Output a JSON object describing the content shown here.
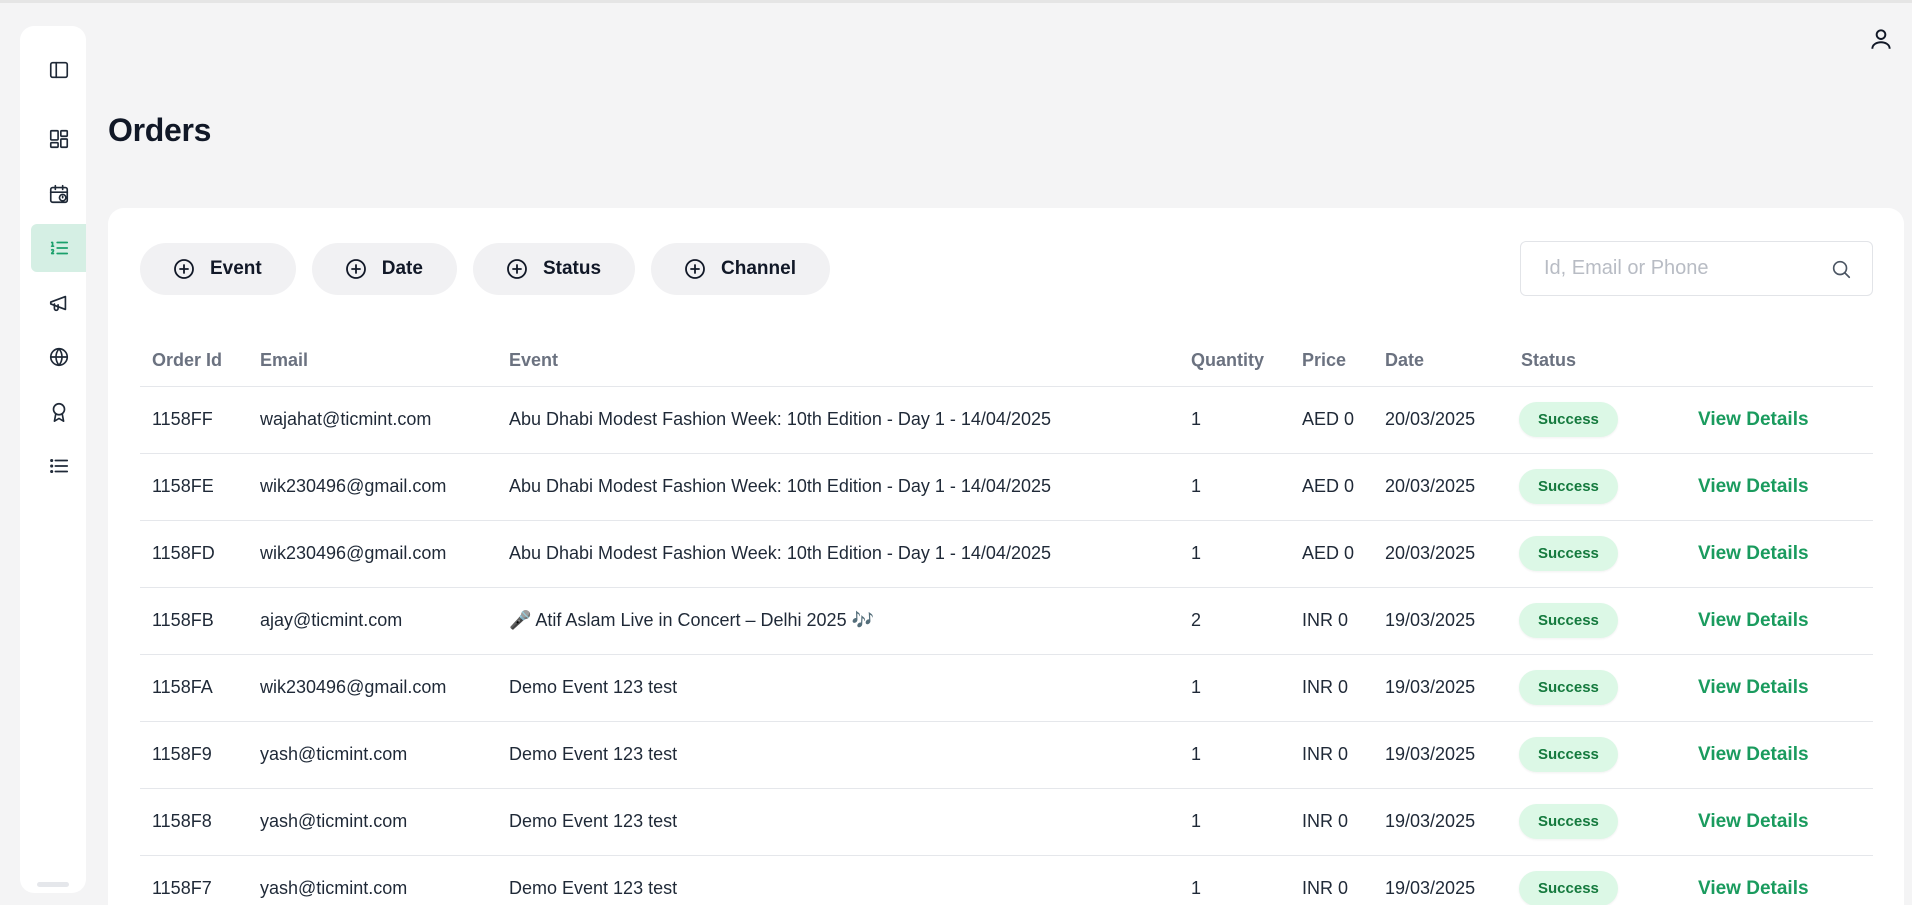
{
  "page": {
    "title": "Orders"
  },
  "sidebar": {
    "items": [
      {
        "name": "sidebar-toggle",
        "icon": "sidebar-toggle-icon"
      },
      {
        "name": "dashboard",
        "icon": "dashboard-icon"
      },
      {
        "name": "events",
        "icon": "calendar-icon"
      },
      {
        "name": "orders",
        "icon": "ordered-list-icon",
        "active": true
      },
      {
        "name": "marketing",
        "icon": "megaphone-icon"
      },
      {
        "name": "web",
        "icon": "globe-icon"
      },
      {
        "name": "rewards",
        "icon": "badge-icon"
      },
      {
        "name": "list",
        "icon": "list-icon"
      }
    ]
  },
  "filters": [
    {
      "label": "Event"
    },
    {
      "label": "Date"
    },
    {
      "label": "Status"
    },
    {
      "label": "Channel"
    }
  ],
  "search": {
    "placeholder": "Id, Email or Phone",
    "value": ""
  },
  "table": {
    "headers": [
      "Order Id",
      "Email",
      "Event",
      "Quantity",
      "Price",
      "Date",
      "Status",
      ""
    ],
    "action_label": "View Details",
    "rows": [
      {
        "order_id": "1158FF",
        "email": "wajahat@ticmint.com",
        "event": "Abu Dhabi Modest Fashion Week: 10th Edition - Day 1 - 14/04/2025",
        "quantity": "1",
        "price": "AED 0",
        "date": "20/03/2025",
        "status": "Success"
      },
      {
        "order_id": "1158FE",
        "email": "wik230496@gmail.com",
        "event": "Abu Dhabi Modest Fashion Week: 10th Edition - Day 1 - 14/04/2025",
        "quantity": "1",
        "price": "AED 0",
        "date": "20/03/2025",
        "status": "Success"
      },
      {
        "order_id": "1158FD",
        "email": "wik230496@gmail.com",
        "event": "Abu Dhabi Modest Fashion Week: 10th Edition - Day 1 - 14/04/2025",
        "quantity": "1",
        "price": "AED 0",
        "date": "20/03/2025",
        "status": "Success"
      },
      {
        "order_id": "1158FB",
        "email": "ajay@ticmint.com",
        "event": "🎤 Atif Aslam Live in Concert – Delhi 2025 🎶",
        "quantity": "2",
        "price": "INR 0",
        "date": "19/03/2025",
        "status": "Success"
      },
      {
        "order_id": "1158FA",
        "email": "wik230496@gmail.com",
        "event": "Demo Event 123 test",
        "quantity": "1",
        "price": "INR 0",
        "date": "19/03/2025",
        "status": "Success"
      },
      {
        "order_id": "1158F9",
        "email": "yash@ticmint.com",
        "event": "Demo Event 123 test",
        "quantity": "1",
        "price": "INR 0",
        "date": "19/03/2025",
        "status": "Success"
      },
      {
        "order_id": "1158F8",
        "email": "yash@ticmint.com",
        "event": "Demo Event 123 test",
        "quantity": "1",
        "price": "INR 0",
        "date": "19/03/2025",
        "status": "Success"
      },
      {
        "order_id": "1158F7",
        "email": "yash@ticmint.com",
        "event": "Demo Event 123 test",
        "quantity": "1",
        "price": "INR 0",
        "date": "19/03/2025",
        "status": "Success"
      }
    ]
  },
  "colors": {
    "accent": "#1a9b5e",
    "active_nav_bg": "#d5efe4",
    "badge_bg": "#dcf8e6",
    "badge_text": "#157a3e",
    "page_bg": "#f4f4f5"
  }
}
